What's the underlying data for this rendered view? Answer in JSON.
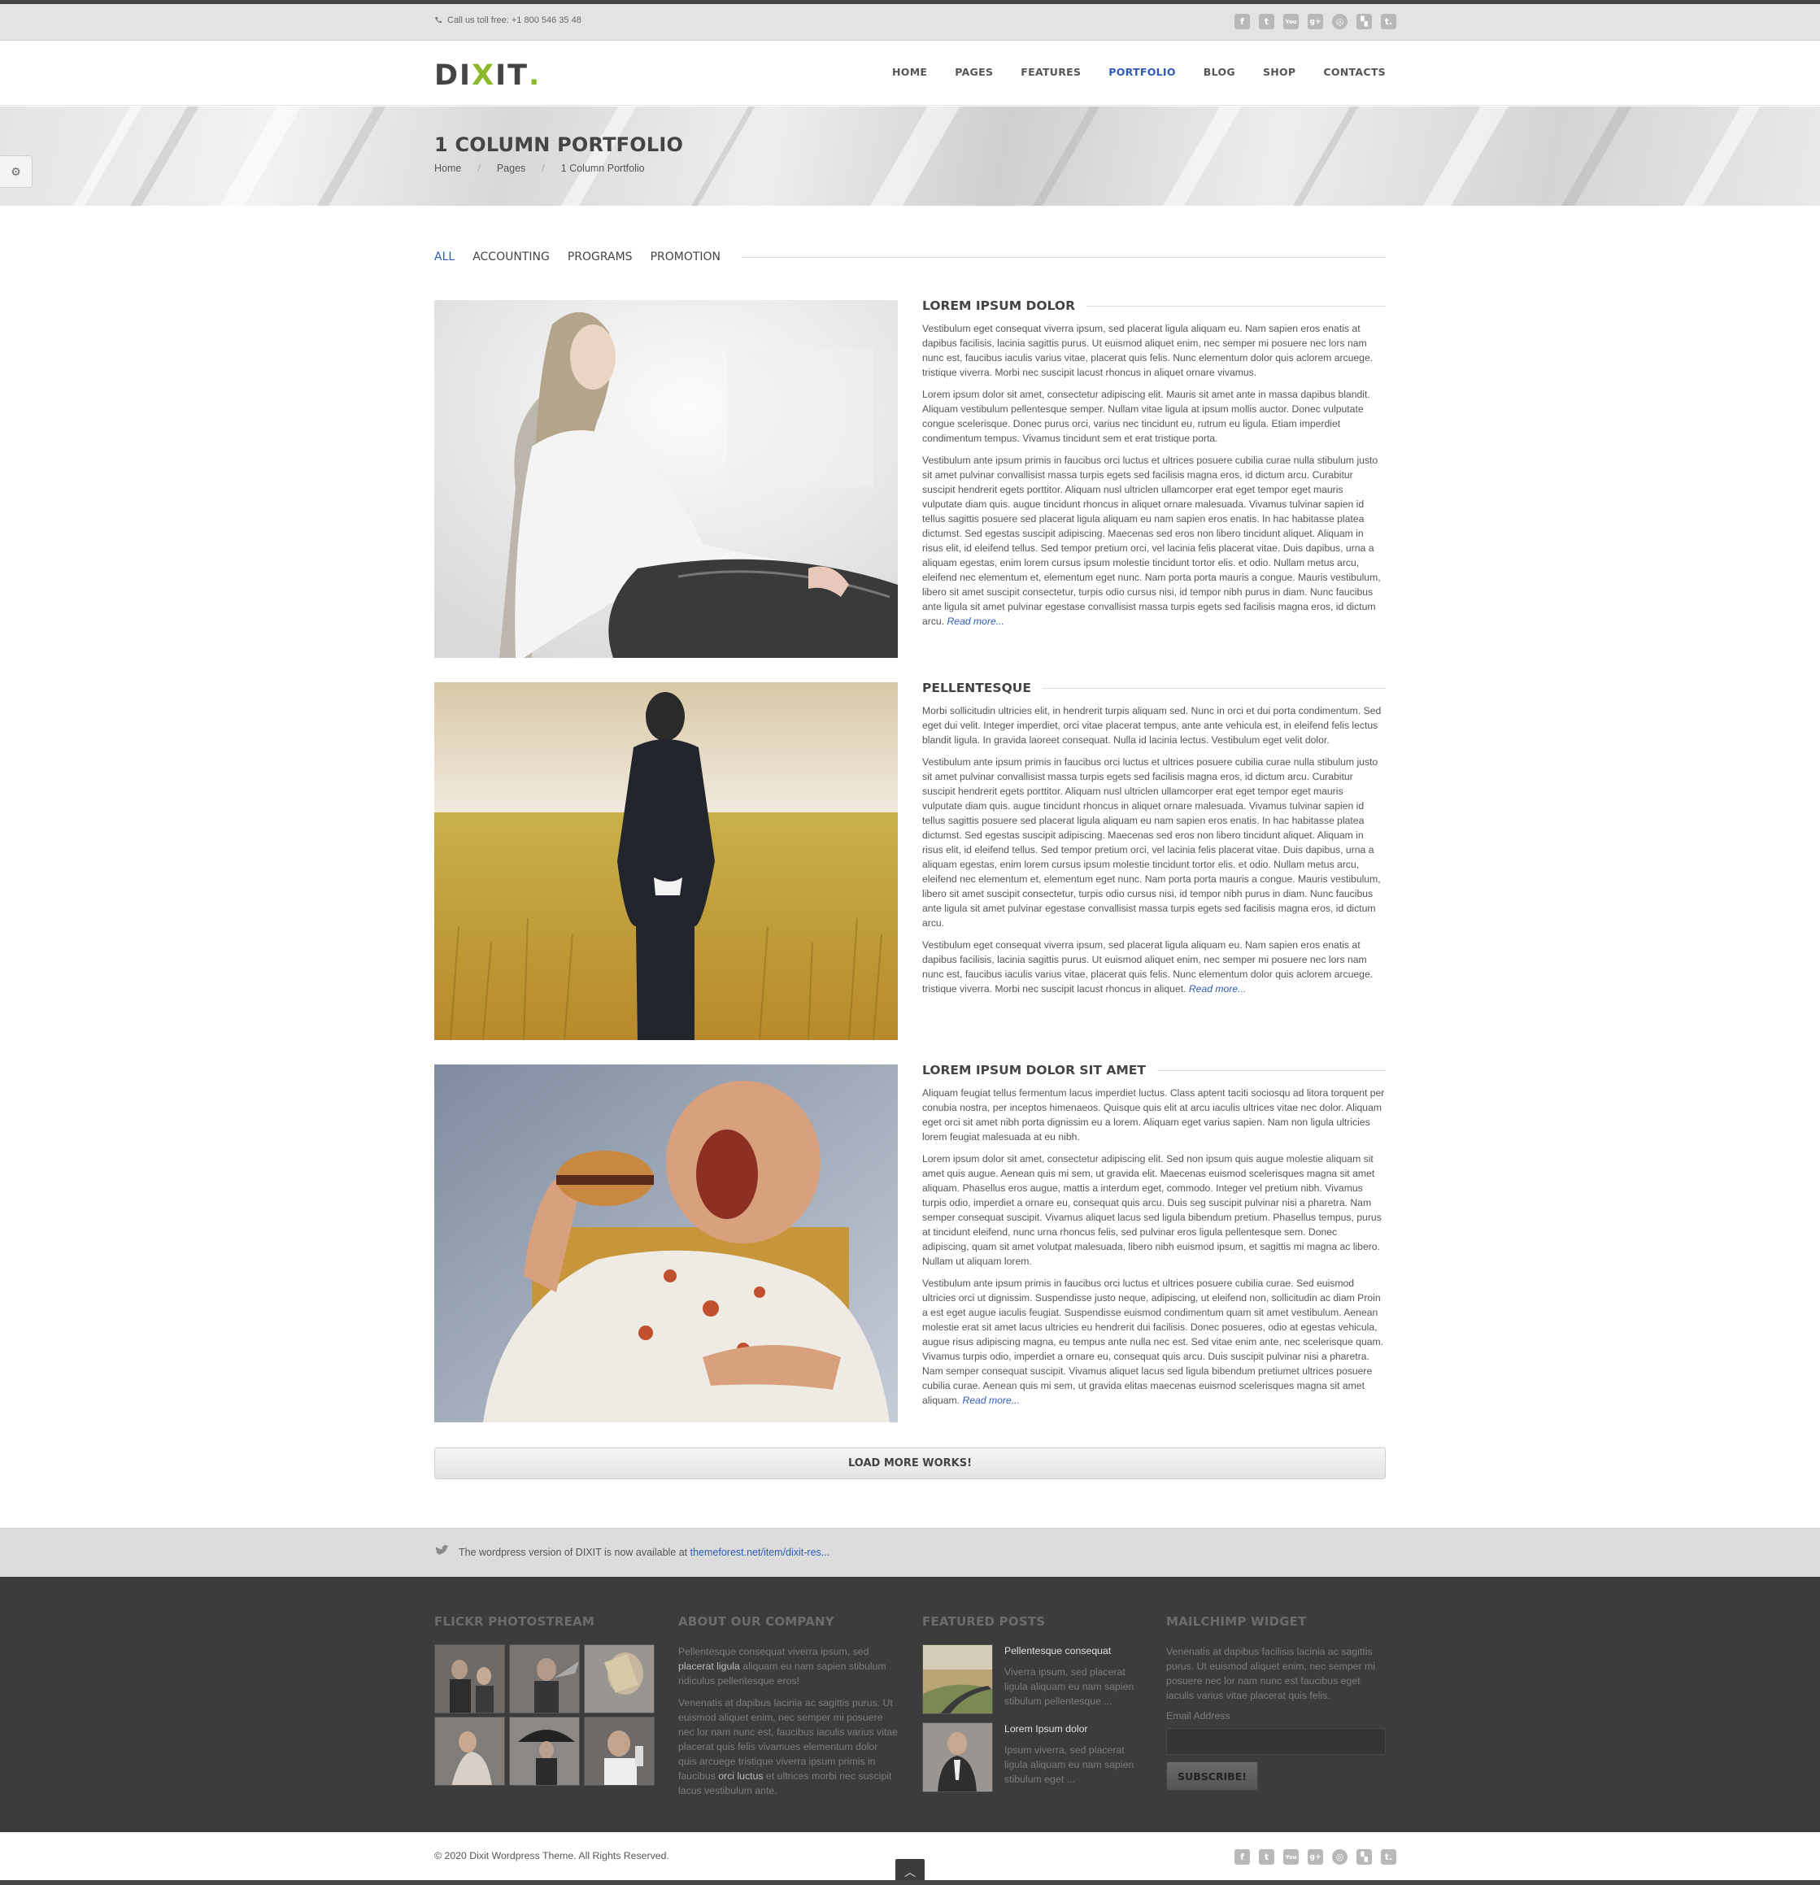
{
  "topbar": {
    "phone": "Call us toll free:  +1 800 546 35 48",
    "social_icons": [
      "facebook-icon",
      "twitter-icon",
      "youtube-icon",
      "google-plus-icon",
      "dribbble-icon",
      "delicious-icon",
      "tumblr-icon"
    ]
  },
  "header": {
    "logo_a": "DI",
    "logo_b": "X",
    "logo_c": "IT",
    "logo_dot": ".",
    "nav": [
      "HOME",
      "PAGES",
      "FEATURES",
      "PORTFOLIO",
      "BLOG",
      "SHOP",
      "CONTACTS"
    ],
    "active_nav": "PORTFOLIO"
  },
  "hero": {
    "title": "1 COLUMN PORTFOLIO",
    "breadcrumbs": [
      "Home",
      "Pages",
      "1 Column Portfolio"
    ],
    "separator": "/"
  },
  "filters": [
    "ALL",
    "ACCOUNTING",
    "PROGRAMS",
    "PROMOTION"
  ],
  "items": [
    {
      "title": "LOREM IPSUM DOLOR",
      "image": "woman-in-white-shirt",
      "paragraphs": [
        "Vestibulum eget consequat viverra ipsum, sed placerat ligula aliquam eu. Nam sapien eros enatis at dapibus facilisis, lacinia sagittis purus. Ut euismod aliquet enim, nec semper mi posuere nec lors nam nunc est, faucibus iaculis varius vitae, placerat quis felis. Nunc elementum dolor quis aclorem arcuege. tristique viverra. Morbi nec suscipit lacust rhoncus in aliquet ornare vivamus.",
        "Lorem ipsum dolor sit amet, consectetur adipiscing elit. Mauris sit amet ante in massa dapibus blandit. Aliquam vestibulum pellentesque semper. Nullam vitae ligula at ipsum mollis auctor. Donec vulputate congue scelerisque. Donec purus orci, varius nec tincidunt eu, rutrum eu ligula. Etiam imperdiet condimentum tempus. Vivamus tincidunt sem et erat tristique porta.",
        "Vestibulum ante ipsum primis in faucibus orci luctus et ultrices posuere cubilia curae nulla stibulum justo sit amet pulvinar convallisist massa turpis egets sed facilisis magna eros, id dictum arcu. Curabitur suscipit hendrerit egets porttitor. Aliquam nusl ultriclen ullamcorper erat eget tempor eget mauris vulputate diam quis. augue tincidunt rhoncus in aliquet ornare malesuada. Vivamus tulvinar sapien id tellus sagittis posuere sed placerat ligula aliquam eu nam sapien eros enatis. In hac habitasse platea dictumst. Sed egestas suscipit adipiscing. Maecenas sed eros non libero tincidunt aliquet. Aliquam in risus elit, id eleifend tellus. Sed tempor pretium orci, vel lacinia felis placerat vitae. Duis dapibus, urna a aliquam egestas, enim lorem cursus ipsum molestie tincidunt tortor elis. et odio. Nullam metus arcu, eleifend nec elementum et, elementum eget nunc. Nam porta porta mauris a congue. Mauris vestibulum, libero sit amet suscipit consectetur, turpis odio cursus nisi, id tempor nibh purus in diam. Nunc faucibus ante ligula sit amet pulvinar egestase convallisist massa turpis egets sed facilisis magna eros, id dictum arcu."
      ],
      "read_more": "Read more..."
    },
    {
      "title": "PELLENTESQUE",
      "image": "man-in-wheat-field",
      "paragraphs": [
        "Morbi sollicitudin ultricies elit, in hendrerit turpis aliquam sed. Nunc in orci et dui porta condimentum. Sed eget dui velit. Integer imperdiet, orci vitae placerat tempus, ante ante vehicula est, in eleifend felis lectus blandit ligula. In gravida laoreet consequat. Nulla id lacinia lectus. Vestibulum eget velit dolor.",
        "Vestibulum ante ipsum primis in faucibus orci luctus et ultrices posuere cubilia curae nulla stibulum justo sit amet pulvinar convallisist massa turpis egets sed facilisis magna eros, id dictum arcu. Curabitur suscipit hendrerit egets porttitor. Aliquam nusl ultriclen ullamcorper erat eget tempor eget mauris vulputate diam quis. augue tincidunt rhoncus in aliquet ornare malesuada. Vivamus tulvinar sapien id tellus sagittis posuere sed placerat ligula aliquam eu nam sapien eros enatis. In hac habitasse platea dictumst. Sed egestas suscipit adipiscing. Maecenas sed eros non libero tincidunt aliquet. Aliquam in risus elit, id eleifend tellus. Sed tempor pretium orci, vel lacinia felis placerat vitae. Duis dapibus, urna a aliquam egestas, enim lorem cursus ipsum molestie tincidunt tortor elis. et odio. Nullam metus arcu, eleifend nec elementum et, elementum eget nunc. Nam porta porta mauris a congue. Mauris vestibulum, libero sit amet suscipit consectetur, turpis odio cursus nisi, id tempor nibh purus in diam. Nunc faucibus ante ligula sit amet pulvinar egestase convallisist massa turpis egets sed facilisis magna eros, id dictum arcu.",
        "Vestibulum eget consequat viverra ipsum, sed placerat ligula aliquam eu. Nam sapien eros enatis at dapibus facilisis, lacinia sagittis purus. Ut euismod aliquet enim, nec semper mi posuere nec lors nam nunc est, faucibus iaculis varius vitae, placerat quis felis. Nunc elementum dolor quis aclorem arcuege. tristique viverra. Morbi nec suscipit lacust rhoncus in aliquet."
      ],
      "read_more": "Read more..."
    },
    {
      "title": "LOREM IPSUM DOLOR SIT AMET",
      "image": "man-eating-burger",
      "paragraphs": [
        "Aliquam feugiat tellus fermentum lacus imperdiet luctus. Class aptent taciti sociosqu ad litora torquent per conubia nostra, per inceptos himenaeos. Quisque quis elit at arcu iaculis ultrices vitae nec dolor. Aliquam eget orci sit amet nibh porta dignissim eu a lorem. Aliquam eget varius sapien. Nam non ligula ultricies lorem feugiat malesuada at eu nibh.",
        "Lorem ipsum dolor sit amet, consectetur adipiscing elit. Sed non ipsum quis augue molestie aliquam sit amet quis augue. Aenean quis mi sem, ut gravida elit. Maecenas euismod scelerisques magna sit amet aliquam. Phasellus eros augue, mattis a interdum eget, commodo. Integer vel pretium nibh. Vivamus turpis odio, imperdiet a ornare eu, consequat quis arcu. Duis seg suscipit pulvinar nisi a pharetra. Nam semper consequat suscipit. Vivamus aliquet lacus sed ligula bibendum pretium. Phasellus tempus, purus at tincidunt eleifend, nunc urna rhoncus felis, sed pulvinar eros ligula pellentesque sem. Donec adipiscing, quam sit amet volutpat malesuada, libero nibh euismod ipsum, et sagittis mi magna ac libero. Nullam ut aliquam lorem.",
        "Vestibulum ante ipsum primis in faucibus orci luctus et ultrices posuere cubilia curae. Sed euismod ultricies orci ut dignissim. Suspendisse justo neque, adipiscing, ut eleifend non, sollicitudin ac diam Proin a est eget augue iaculis feugiat. Suspendisse euismod condimentum quam sit amet vestibulum. Aenean molestie erat sit amet lacus ultricies eu hendrerit dui facilisis. Donec posueres, odio at egestas vehicula, augue risus adipiscing magna, eu tempus ante nulla nec est. Sed vitae enim ante, nec scelerisque quam. Vivamus turpis odio, imperdiet a ornare eu, consequat quis arcu. Duis suscipit pulvinar nisi a pharetra. Nam semper consequat suscipit. Vivamus aliquet lacus sed ligula bibendum pretiumet ultrices posuere cubilia curae. Aenean quis mi sem, ut gravida elitas maecenas euismod scelerisques magna sit amet aliquam."
      ],
      "read_more": "Read more..."
    }
  ],
  "load_more": "LOAD MORE WORKS!",
  "tweet": {
    "text": "The wordpress version of DIXIT is now available at ",
    "link": "themeforest.net/item/dixit-res..."
  },
  "footer": {
    "flickr_title": "FLICKR PHOTOSTREAM",
    "about_title": "ABOUT OUR COMPANY",
    "about_p1_a": "Pellentesque consequat viverra ipsum, sed ",
    "about_p1_b": "placerat ligula",
    "about_p1_c": " aliquam eu nam sapien stibulum ridiculus pellentesque eros!",
    "about_p2_a": "Venenatis at dapibus lacinia ac sagittis purus. Ut euismod aliquet enim, nec semper mi posuere nec lor nam nunc est, faucibus iaculis varius vitae placerat quis felis vivamues elementum dolor quis arcuege tristique viverra ipsum primis in faucibus ",
    "about_p2_b": "orci luctus",
    "about_p2_c": " et ultrices morbi nec suscipit lacus vestibulum ante.",
    "featured_title": "FEATURED POSTS",
    "posts": [
      {
        "title": "Pellentesque consequat",
        "desc": "Viverra ipsum, sed placerat ligula aliquam eu nam sapien stibulum pellentesque ..."
      },
      {
        "title": "Lorem Ipsum dolor",
        "desc": "Ipsum viverra, sed placerat ligula aliquam eu nam sapien stibulum eget ..."
      }
    ],
    "mailchimp_title": "MAILCHIMP WIDGET",
    "mailchimp_text": "Venenatis at dapibus facilisis lacinia ac sagittis purus. Ut euismod aliquet enim, nec semper mi posuere nec lor nam nunc est faucibus eget iaculis varius vitae placerat quis felis.",
    "email_label": "Email Address",
    "subscribe": "SUBSCRIBE!"
  },
  "copyright": "© 2020 Dixit Wordpress Theme. All Rights Reserved.",
  "colors": {
    "accent": "#2f5bb4",
    "logo_green": "#8cb82b",
    "footer_bg": "#3c3c3c"
  }
}
